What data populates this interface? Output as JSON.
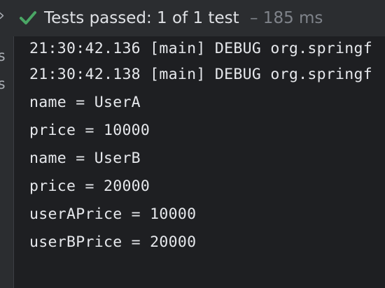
{
  "header": {
    "chevron": "›",
    "status_text": "Tests passed: 1 of 1 test",
    "duration_text": "– 185 ms",
    "check_icon": "check-icon",
    "check_color": "#4aa665"
  },
  "gutter": {
    "letters": [
      "s",
      "s"
    ]
  },
  "console": {
    "lines": [
      "21:30:42.136 [main] DEBUG org.springf",
      "21:30:42.138 [main] DEBUG org.springf",
      "name = UserA",
      "price = 10000",
      "name = UserB",
      "price = 20000",
      "userAPrice = 10000",
      "userBPrice = 20000"
    ]
  }
}
